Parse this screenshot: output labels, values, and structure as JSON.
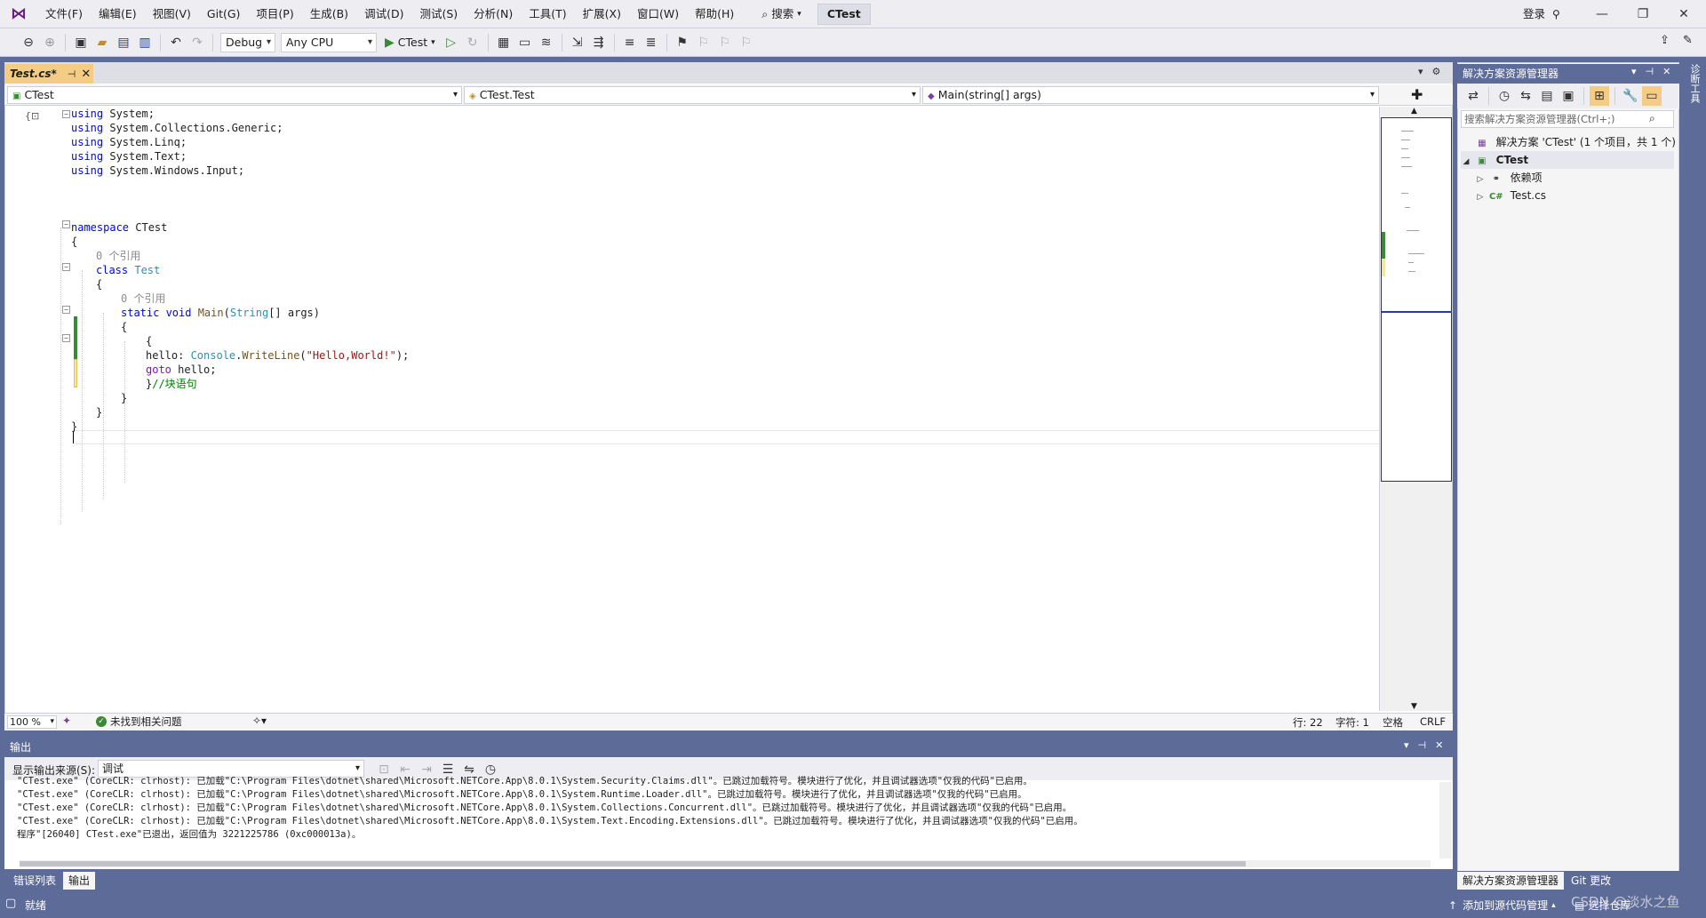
{
  "menubar": {
    "items": [
      "文件(F)",
      "编辑(E)",
      "视图(V)",
      "Git(G)",
      "项目(P)",
      "生成(B)",
      "调试(D)",
      "测试(S)",
      "分析(N)",
      "工具(T)",
      "扩展(X)",
      "窗口(W)",
      "帮助(H)"
    ],
    "search_label": "搜索",
    "title": "CTest",
    "login": "登录"
  },
  "toolbar": {
    "config": "Debug",
    "platform": "Any CPU",
    "run_label": "CTest"
  },
  "editor": {
    "tab_name": "Test.cs*",
    "nav_project": "CTest",
    "nav_class": "CTest.Test",
    "nav_member": "Main(string[] args)",
    "code": {
      "using1_kw": "using",
      "using1_ns": " System;",
      "using2_kw": "using",
      "using2_ns": " System.Collections.Generic;",
      "using3_kw": "using",
      "using3_ns": " System.Linq;",
      "using4_kw": "using",
      "using4_ns": " System.Text;",
      "using5_kw": "using",
      "using5_ns": " System.Windows.Input;",
      "ns_kw": "namespace",
      "ns_name": " CTest",
      "open1": "{",
      "lens1": "0 个引用",
      "class_kw": "class",
      "class_name": " Test",
      "open2": "{",
      "lens2": "0 个引用",
      "static_kw": "static",
      "void_kw": " void",
      "main_fn": " Main",
      "paren_open": "(",
      "string_ty": "String",
      "args": "[] args)",
      "open3": "{",
      "open4": "{",
      "hello_label": "hello: ",
      "console_ty": "Console",
      "dot": ".",
      "writeline_fn": "WriteLine",
      "str_open": "(",
      "hello_str": "\"Hello,World!\"",
      "str_close": ");",
      "goto_kw": "goto",
      "goto_target": " hello;",
      "close4": "}",
      "block_comment": "//块语句",
      "close3": "}",
      "close2": "}",
      "close1": "}"
    },
    "zoom": "100 %",
    "issues": "未找到相关问题",
    "line": "行: 22",
    "char": "字符: 1",
    "whitespace": "空格",
    "eol": "CRLF"
  },
  "output": {
    "title": "输出",
    "source_label": "显示输出来源(S):",
    "source_value": "调试",
    "lines": [
      "\"CTest.exe\" (CoreCLR: clrhost): 已加载\"C:\\Program Files\\dotnet\\shared\\Microsoft.NETCore.App\\8.0.1\\System.Security.Claims.dll\"。已跳过加载符号。模块进行了优化，并且调试器选项\"仅我的代码\"已启用。",
      "\"CTest.exe\" (CoreCLR: clrhost): 已加载\"C:\\Program Files\\dotnet\\shared\\Microsoft.NETCore.App\\8.0.1\\System.Runtime.Loader.dll\"。已跳过加载符号。模块进行了优化，并且调试器选项\"仅我的代码\"已启用。",
      "\"CTest.exe\" (CoreCLR: clrhost): 已加载\"C:\\Program Files\\dotnet\\shared\\Microsoft.NETCore.App\\8.0.1\\System.Collections.Concurrent.dll\"。已跳过加载符号。模块进行了优化，并且调试器选项\"仅我的代码\"已启用。",
      "\"CTest.exe\" (CoreCLR: clrhost): 已加载\"C:\\Program Files\\dotnet\\shared\\Microsoft.NETCore.App\\8.0.1\\System.Text.Encoding.Extensions.dll\"。已跳过加载符号。模块进行了优化，并且调试器选项\"仅我的代码\"已启用。",
      "程序\"[26040] CTest.exe\"已退出，返回值为 3221225786 (0xc000013a)。"
    ],
    "tabs": [
      "错误列表",
      "输出"
    ]
  },
  "solution_explorer": {
    "title": "解决方案资源管理器",
    "search_placeholder": "搜索解决方案资源管理器(Ctrl+;)",
    "solution": "解决方案 'CTest' (1 个项目，共 1 个)",
    "project": "CTest",
    "dependencies": "依赖项",
    "file": "Test.cs",
    "tabs": [
      "解决方案资源管理器",
      "Git 更改"
    ]
  },
  "right_strip_label": "诊断工具",
  "status": {
    "ready": "就绪",
    "add_source": "添加到源代码管理",
    "select_repo": "选择仓库",
    "watermark": "CSDN @淡水之鱼"
  }
}
